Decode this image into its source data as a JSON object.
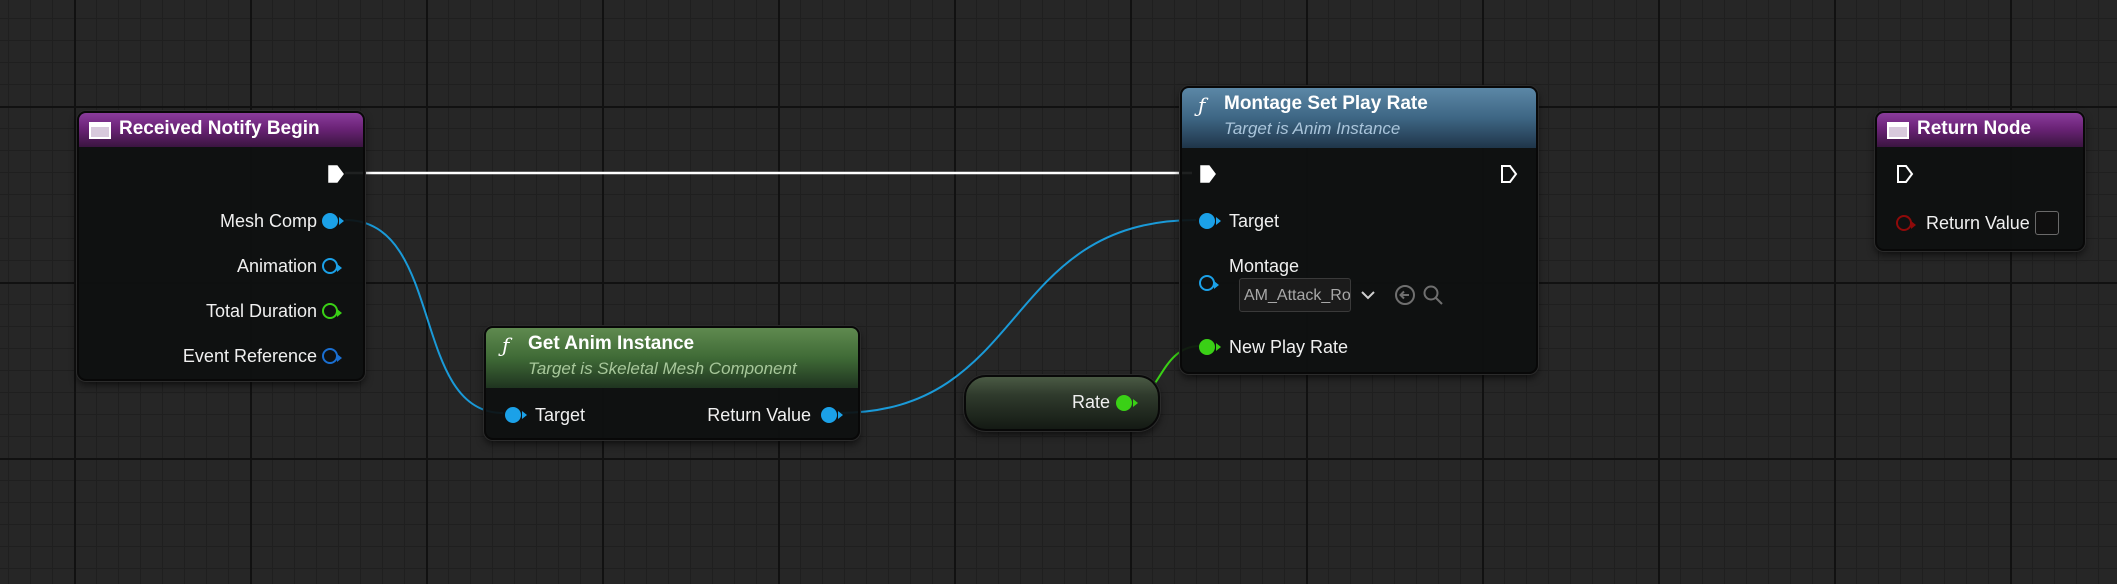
{
  "nodes": {
    "received_notify_begin": {
      "title": "Received Notify Begin",
      "icon": "event-icon",
      "header_color": "#6b2377",
      "pins": {
        "mesh_comp": "Mesh Comp",
        "animation": "Animation",
        "total_duration": "Total Duration",
        "event_reference": "Event Reference"
      }
    },
    "get_anim_instance": {
      "title": "Get Anim Instance",
      "subtitle": "Target is Skeletal Mesh Component",
      "icon": "function-icon",
      "icon_glyph": "ƒ",
      "header_color": "#3f6a36",
      "pins": {
        "target": "Target",
        "return_value": "Return Value"
      }
    },
    "rate": {
      "label": "Rate"
    },
    "montage_set_play_rate": {
      "title": "Montage Set Play Rate",
      "subtitle": "Target is Anim Instance",
      "icon": "function-icon",
      "icon_glyph": "ƒ",
      "header_color": "#3e6684",
      "pins": {
        "target": "Target",
        "montage": "Montage",
        "montage_value": "AM_Attack_Root",
        "new_play_rate": "New Play Rate"
      }
    },
    "return_node": {
      "title": "Return Node",
      "icon": "event-icon",
      "header_color": "#6b2377",
      "pins": {
        "return_value": "Return Value"
      }
    }
  },
  "pin_colors": {
    "exec": "#ffffff",
    "object": "#1ba1e8",
    "anim_sequence": "#1ba1e8",
    "float": "#3ad016",
    "event_reference": "#1a6fd1",
    "bool": "#8f0a0a",
    "wire_object": "#1a9ad8",
    "wire_float": "#3ad016"
  }
}
